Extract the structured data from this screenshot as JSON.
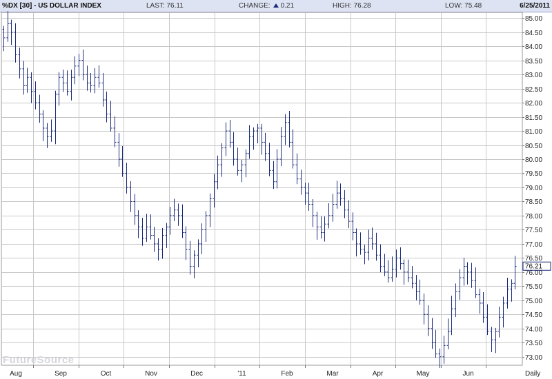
{
  "header": {
    "symbol_title": "%DX [30] - US DOLLAR INDEX",
    "last_label": "LAST:",
    "last_value": "76.11",
    "change_label": "CHANGE:",
    "change_value": "0.21",
    "high_label": "HIGH:",
    "high_value": "76.28",
    "low_label": "LOW:",
    "low_value": "75.48",
    "date": "6/25/2011"
  },
  "watermark": "FutureSource",
  "period_label": "Daily",
  "current_price_label": "76.21",
  "colors": {
    "bars": "#1a2a7a",
    "grid": "#c8c8c8",
    "header_bg": "#dde3f3"
  },
  "chart_data": {
    "type": "ohlc",
    "title": "%DX [30] - US DOLLAR INDEX",
    "ylim": [
      72.7,
      85.2
    ],
    "y_ticks": [
      73.0,
      73.5,
      74.0,
      74.5,
      75.0,
      75.5,
      76.0,
      76.5,
      77.0,
      77.5,
      78.0,
      78.5,
      79.0,
      79.5,
      80.0,
      80.5,
      81.0,
      81.5,
      82.0,
      82.5,
      83.0,
      83.5,
      84.0,
      84.5,
      85.0
    ],
    "x_months": [
      "Aug",
      "Sep",
      "Oct",
      "Nov",
      "Dec",
      "'11",
      "Feb",
      "Mar",
      "Apr",
      "May",
      "Jun"
    ],
    "close_series": [
      84.3,
      84.8,
      84.5,
      83.7,
      83.2,
      82.6,
      82.9,
      82.4,
      82.0,
      81.6,
      81.1,
      80.8,
      81.0,
      82.3,
      82.9,
      82.7,
      82.4,
      82.9,
      83.3,
      83.5,
      83.0,
      82.7,
      82.6,
      82.9,
      82.7,
      82.1,
      81.6,
      81.1,
      80.6,
      80.0,
      79.5,
      79.0,
      78.5,
      78.0,
      77.6,
      77.2,
      77.6,
      77.3,
      77.0,
      76.8,
      77.3,
      77.6,
      78.0,
      78.2,
      78.0,
      77.4,
      76.8,
      76.2,
      76.6,
      77.0,
      77.5,
      78.0,
      78.6,
      79.2,
      79.8,
      80.4,
      81.0,
      80.6,
      80.0,
      79.6,
      79.8,
      80.2,
      80.8,
      81.0,
      81.1,
      80.6,
      80.2,
      79.6,
      79.2,
      80.0,
      80.8,
      81.3,
      80.6,
      79.8,
      79.3,
      79.0,
      78.8,
      78.4,
      78.0,
      77.6,
      77.4,
      77.7,
      78.0,
      78.4,
      78.8,
      78.6,
      78.2,
      77.8,
      77.4,
      77.0,
      76.8,
      76.7,
      77.2,
      77.0,
      76.6,
      76.2,
      76.0,
      75.8,
      76.1,
      76.5,
      76.3,
      76.0,
      75.8,
      75.6,
      75.3,
      75.0,
      74.5,
      74.0,
      73.5,
      73.1,
      73.0,
      73.4,
      73.9,
      74.7,
      75.3,
      75.8,
      76.2,
      76.0,
      75.7,
      75.2,
      74.9,
      74.4,
      73.9,
      73.6,
      73.9,
      74.4,
      74.9,
      75.4,
      75.6,
      76.2
    ]
  }
}
